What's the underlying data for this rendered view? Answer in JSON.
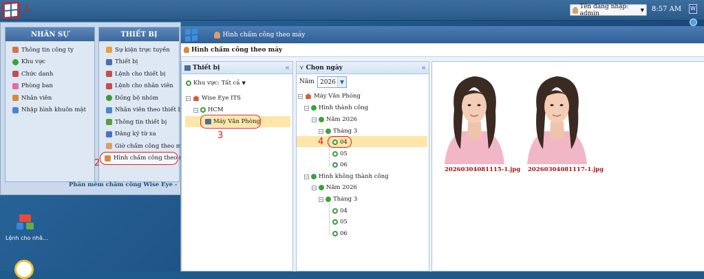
{
  "taskbar": {
    "step_1": "1",
    "login_label": "Tên đăng nhập: admin",
    "clock": "8:57 AM"
  },
  "start_menu": {
    "col1": {
      "header": "NHÂN SỰ",
      "items": [
        "Thông tin công ty",
        "Khu vực",
        "Chức danh",
        "Phòng ban",
        "Nhân viên",
        "Nhập hình khuôn mặt"
      ]
    },
    "col2": {
      "header": "THIẾT BỊ",
      "items": [
        "Sự kiện trực tuyến",
        "Thiết bị",
        "Lệnh cho thiết bị",
        "Lệnh cho nhân viên",
        "Đồng bộ nhóm",
        "Nhân viên theo thiết bị",
        "Thông tin thiết bị",
        "Đăng ký từ xa",
        "Giờ chấm công theo máy",
        "Hình chấm công theo máy"
      ]
    },
    "step_2": "2",
    "footer": "Phần mềm chấm công Wise Eye - Phiên bản"
  },
  "desktop": {
    "icon_label": "Lệnh cho nhâ..."
  },
  "app": {
    "window_title": "Hình chấm công theo máy",
    "tab_title": "Hình chấm công theo máy",
    "device_pane": {
      "header": "Thiết bị",
      "area_filter": "Khu vực: Tất cả",
      "tree": {
        "root": "Wise Eye ITS",
        "area": "HCM",
        "device": "Máy Văn Phòng"
      },
      "step_3": "3"
    },
    "date_pane": {
      "header": "Chọn ngày",
      "year_label": "Năm",
      "year_value": "2026",
      "tree": {
        "root": "Máy Văn Phòng",
        "success": "Hình thành công",
        "success_year": "Năm 2026",
        "success_month": "Tháng 3",
        "success_days": [
          "04",
          "05",
          "06"
        ],
        "fail": "Hình không thành công",
        "fail_year": "Năm 2026",
        "fail_month": "Tháng 3",
        "fail_days": [
          "04",
          "05",
          "06"
        ]
      },
      "step_4": "4"
    },
    "photos": [
      "20260304081115-1.jpg",
      "20260304081117-1.jpg"
    ]
  },
  "colors": {
    "annotation_red": "#e31b1b",
    "selected_row": "#fde6a8",
    "caption_red": "#a31515"
  }
}
